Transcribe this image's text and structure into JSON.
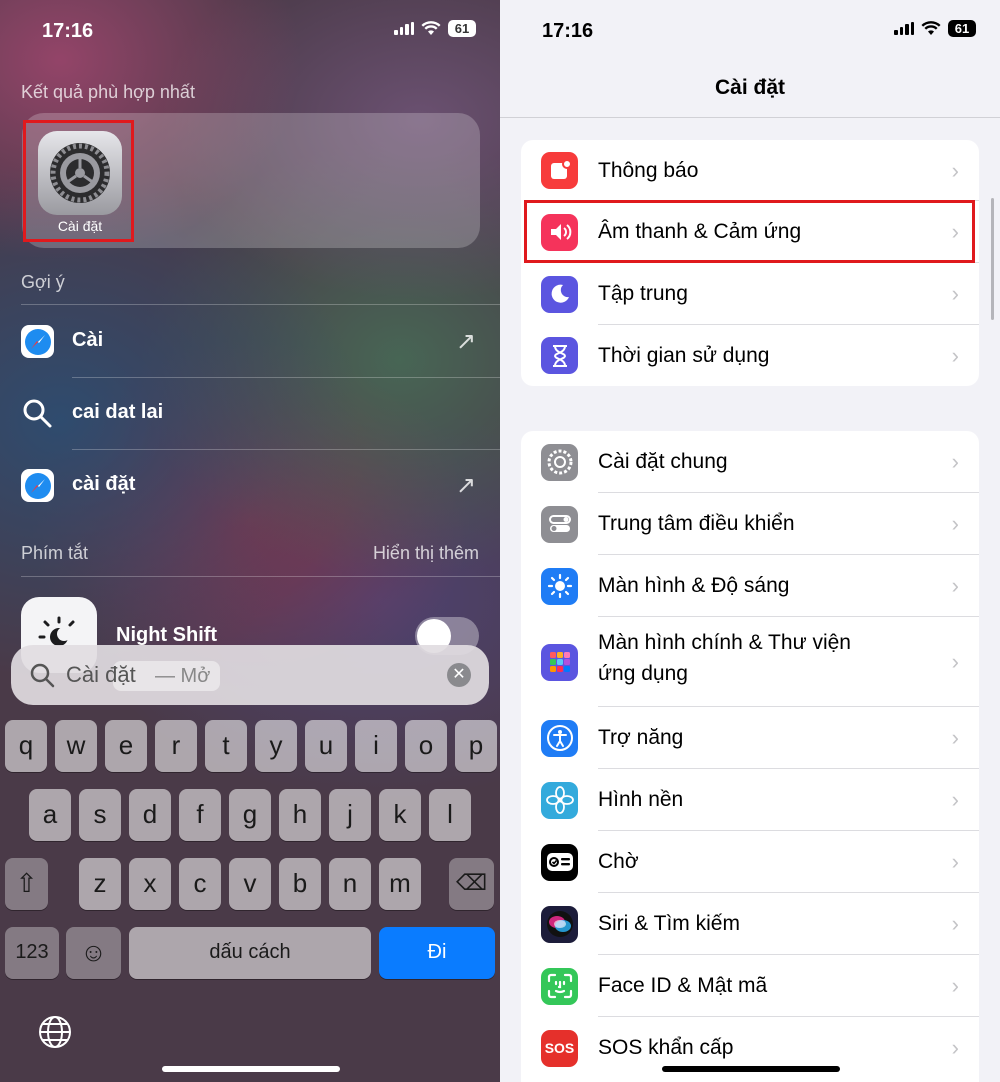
{
  "left": {
    "status": {
      "time": "17:16",
      "battery": "61"
    },
    "top_hit": {
      "section_title": "Kết quả phù hợp nhất",
      "app_label": "Cài đặt"
    },
    "suggestions": {
      "section_title": "Gợi ý",
      "items": [
        {
          "text": "Cài",
          "icon": "safari-icon"
        },
        {
          "text": "cai dat lai",
          "icon": "search-icon"
        },
        {
          "text": "cài đặt",
          "icon": "safari-icon"
        }
      ]
    },
    "shortcuts": {
      "section_title": "Phím tắt",
      "show_more": "Hiển thị thêm",
      "item_label": "Night Shift"
    },
    "search": {
      "query": "Cài đặt",
      "hint": "— Mở"
    },
    "keyboard": {
      "row1": [
        "q",
        "w",
        "e",
        "r",
        "t",
        "y",
        "u",
        "i",
        "o",
        "p"
      ],
      "row2": [
        "a",
        "s",
        "d",
        "f",
        "g",
        "h",
        "j",
        "k",
        "l"
      ],
      "row3": [
        "z",
        "x",
        "c",
        "v",
        "b",
        "n",
        "m"
      ],
      "numbers_key": "123",
      "space_key": "dấu cách",
      "go_key": "Đi"
    }
  },
  "right": {
    "status": {
      "time": "17:16",
      "battery": "61"
    },
    "title": "Cài đặt",
    "group1": [
      {
        "label": "Thông báo",
        "icon": "notifications-icon",
        "color": "#f73b3b"
      },
      {
        "label": "Âm thanh & Cảm ứng",
        "icon": "sound-icon",
        "color": "#f5335b"
      },
      {
        "label": "Tập trung",
        "icon": "focus-moon-icon",
        "color": "#5b55e0"
      },
      {
        "label": "Thời gian sử dụng",
        "icon": "hourglass-icon",
        "color": "#5b55e0"
      }
    ],
    "group2": [
      {
        "label": "Cài đặt chung",
        "icon": "gear-icon",
        "color": "#8e8e93"
      },
      {
        "label": "Trung tâm điều khiển",
        "icon": "control-center-icon",
        "color": "#8e8e93"
      },
      {
        "label": "Màn hình & Độ sáng",
        "icon": "brightness-icon",
        "color": "#1f7cf5"
      },
      {
        "label": "Màn hình chính & Thư viện",
        "label2": "ứng dụng",
        "icon": "home-screen-icon",
        "color": "#5b55e0"
      },
      {
        "label": "Trợ năng",
        "icon": "accessibility-icon",
        "color": "#1f7cf5"
      },
      {
        "label": "Hình nền",
        "icon": "wallpaper-icon",
        "color": "#33aadc"
      },
      {
        "label": "Chờ",
        "icon": "standby-icon",
        "color": "#000000"
      },
      {
        "label": "Siri & Tìm kiếm",
        "icon": "siri-icon",
        "color": "#1c1c3a"
      },
      {
        "label": "Face ID & Mật mã",
        "icon": "face-id-icon",
        "color": "#34c759"
      },
      {
        "label": "SOS khẩn cấp",
        "icon": "sos-icon",
        "color": "#e5302b"
      }
    ],
    "sos_text": "SOS"
  },
  "colors": {
    "highlight": "#e0191d",
    "accent": "#0a7cff"
  }
}
